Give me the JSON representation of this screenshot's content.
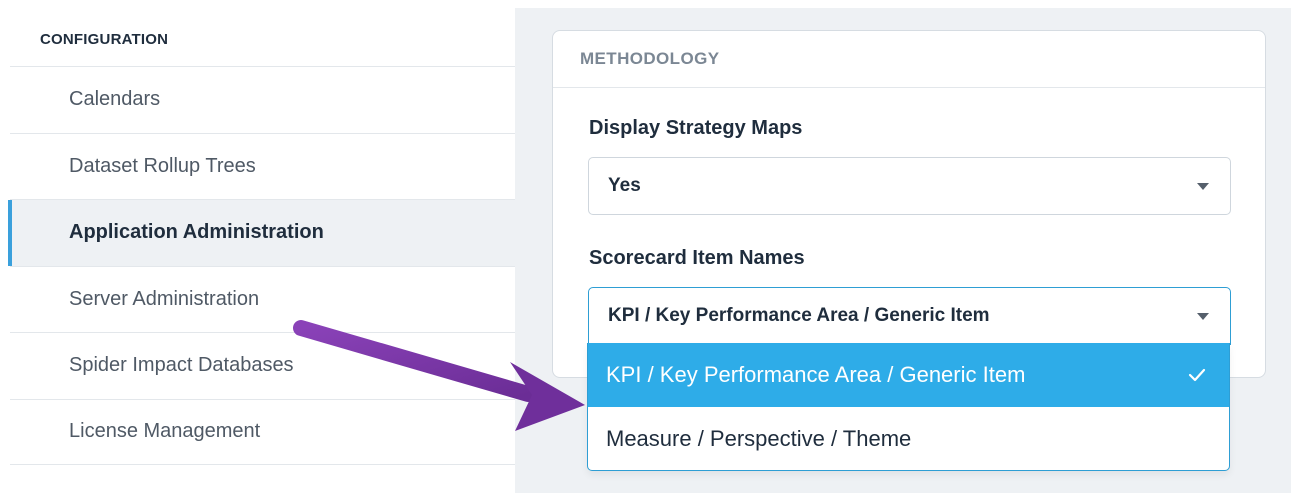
{
  "sidebar": {
    "header": "CONFIGURATION",
    "items": [
      {
        "label": "Calendars"
      },
      {
        "label": "Dataset Rollup Trees"
      },
      {
        "label": "Application Administration",
        "active": true
      },
      {
        "label": "Server Administration"
      },
      {
        "label": "Spider Impact Databases"
      },
      {
        "label": "License Management"
      }
    ]
  },
  "panel": {
    "title": "METHODOLOGY",
    "display_strategy_maps": {
      "label": "Display Strategy Maps",
      "value": "Yes"
    },
    "scorecard_item_names": {
      "label": "Scorecard Item Names",
      "value": "KPI / Key Performance Area / Generic Item",
      "options": [
        {
          "label": "KPI / Key Performance Area / Generic Item",
          "selected": true
        },
        {
          "label": "Measure / Perspective / Theme",
          "selected": false
        }
      ]
    }
  },
  "colors": {
    "accent": "#2eace8",
    "active_indicator": "#3aa0dc",
    "annotation_arrow": "#7b35a6",
    "main_background": "#eef1f4"
  },
  "icons": {
    "select_caret": "caret-down-icon",
    "selected_check": "check-icon",
    "annotation": "arrow-icon"
  }
}
